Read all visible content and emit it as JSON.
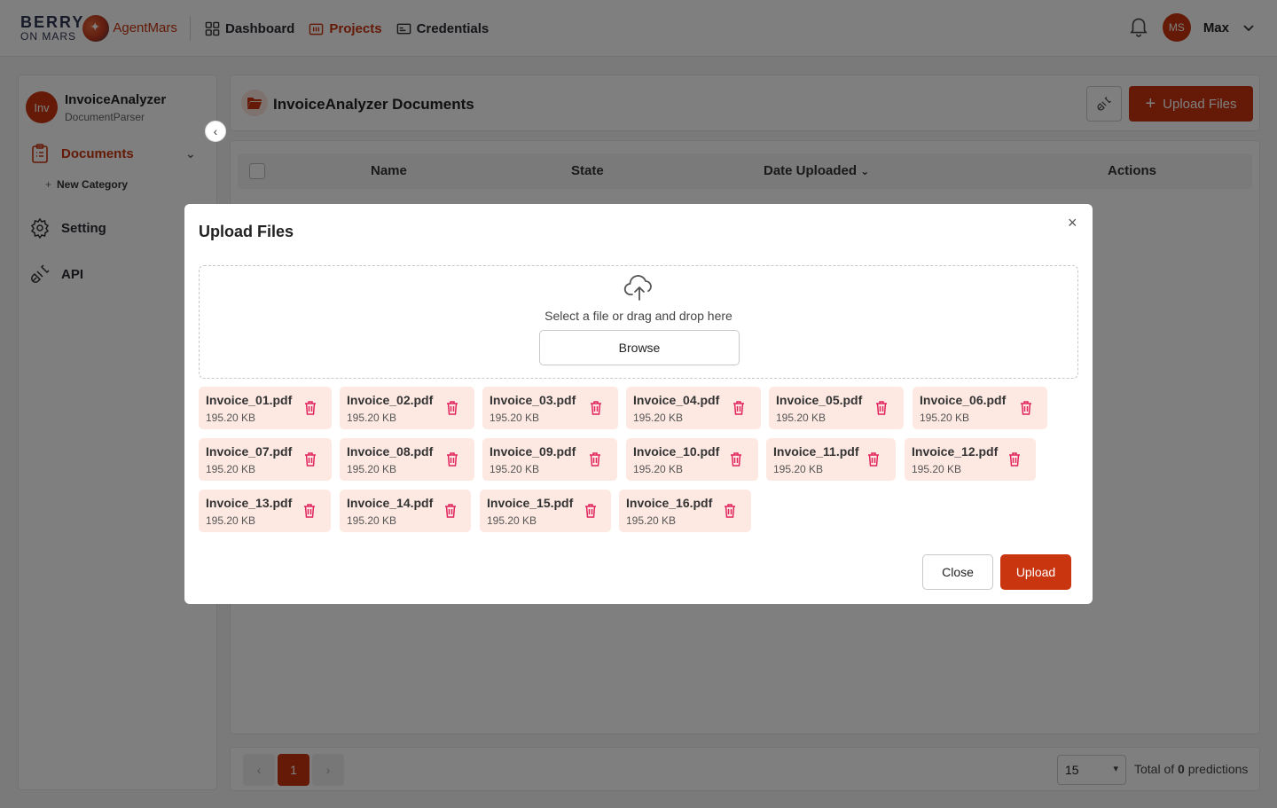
{
  "brand": {
    "berry": "BERRY",
    "on_mars": "ON MARS",
    "agent": "AgentMars"
  },
  "nav": [
    {
      "label": "Dashboard",
      "icon": "grid-icon"
    },
    {
      "label": "Projects",
      "icon": "projects-icon"
    },
    {
      "label": "Credentials",
      "icon": "credentials-icon"
    }
  ],
  "user": {
    "initials": "MS",
    "name": "Max"
  },
  "sidebar": {
    "project_initials": "Inv",
    "project_name": "InvoiceAnalyzer",
    "project_sub": "DocumentParser",
    "documents": "Documents",
    "new_category_plus": "+",
    "new_category": "New Category",
    "setting": "Setting",
    "api": "API"
  },
  "main": {
    "title": "InvoiceAnalyzer Documents",
    "upload_plus": "+",
    "upload_label": "Upload Files",
    "columns": {
      "name": "Name",
      "state": "State",
      "date": "Date Uploaded",
      "actions": "Actions"
    }
  },
  "pager": {
    "prev": "‹",
    "current": "1",
    "next": "›",
    "per_page": "15",
    "total_prefix": "Total of ",
    "total_count": "0",
    "total_suffix": " predictions"
  },
  "modal": {
    "title": "Upload Files",
    "close_x": "×",
    "drop_text": "Select a file or drag and drop here",
    "browse": "Browse",
    "close_btn": "Close",
    "upload_btn": "Upload",
    "files": [
      {
        "name": "Invoice_01.pdf",
        "size": "195.20 KB"
      },
      {
        "name": "Invoice_02.pdf",
        "size": "195.20 KB"
      },
      {
        "name": "Invoice_03.pdf",
        "size": "195.20 KB"
      },
      {
        "name": "Invoice_04.pdf",
        "size": "195.20 KB"
      },
      {
        "name": "Invoice_05.pdf",
        "size": "195.20 KB"
      },
      {
        "name": "Invoice_06.pdf",
        "size": "195.20 KB"
      },
      {
        "name": "Invoice_07.pdf",
        "size": "195.20 KB"
      },
      {
        "name": "Invoice_08.pdf",
        "size": "195.20 KB"
      },
      {
        "name": "Invoice_09.pdf",
        "size": "195.20 KB"
      },
      {
        "name": "Invoice_10.pdf",
        "size": "195.20 KB"
      },
      {
        "name": "Invoice_11.pdf",
        "size": "195.20 KB"
      },
      {
        "name": "Invoice_12.pdf",
        "size": "195.20 KB"
      },
      {
        "name": "Invoice_13.pdf",
        "size": "195.20 KB"
      },
      {
        "name": "Invoice_14.pdf",
        "size": "195.20 KB"
      },
      {
        "name": "Invoice_15.pdf",
        "size": "195.20 KB"
      },
      {
        "name": "Invoice_16.pdf",
        "size": "195.20 KB"
      }
    ]
  },
  "colors": {
    "accent": "#c8350f",
    "chip_bg": "#fde9e2",
    "trash": "#e0245e"
  }
}
